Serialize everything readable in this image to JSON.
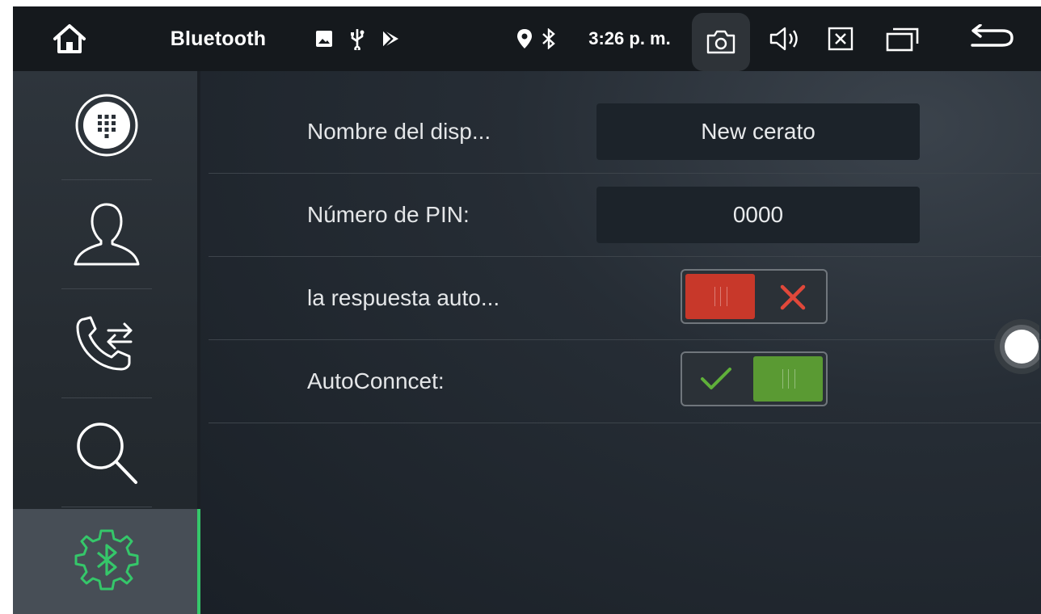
{
  "statusbar": {
    "title": "Bluetooth",
    "time": "3:26 p. m.",
    "icons": [
      "home-icon",
      "image-icon",
      "usb-icon",
      "play-store-icon",
      "location-icon",
      "bluetooth-icon",
      "screenshot-icon",
      "volume-icon",
      "close-window-icon",
      "recent-apps-icon",
      "back-icon"
    ]
  },
  "sidebar": {
    "items": [
      {
        "name": "dialpad",
        "icon": "dialpad-icon"
      },
      {
        "name": "contacts",
        "icon": "contact-icon"
      },
      {
        "name": "call-log",
        "icon": "call-transfer-icon"
      },
      {
        "name": "search",
        "icon": "search-icon"
      },
      {
        "name": "bluetooth-settings",
        "icon": "bluetooth-settings-icon",
        "active": true
      }
    ]
  },
  "settings": {
    "device_name_label": "Nombre del disp...",
    "device_name_value": "New cerato",
    "pin_label": "Número de PIN:",
    "pin_value": "0000",
    "auto_answer_label": "la respuesta auto...",
    "auto_answer_enabled": false,
    "auto_connect_label": "AutoConncet:",
    "auto_connect_enabled": true
  },
  "colors": {
    "accent": "#35c76a",
    "toggle_off": "#c8382a",
    "toggle_on": "#5a9a33"
  }
}
